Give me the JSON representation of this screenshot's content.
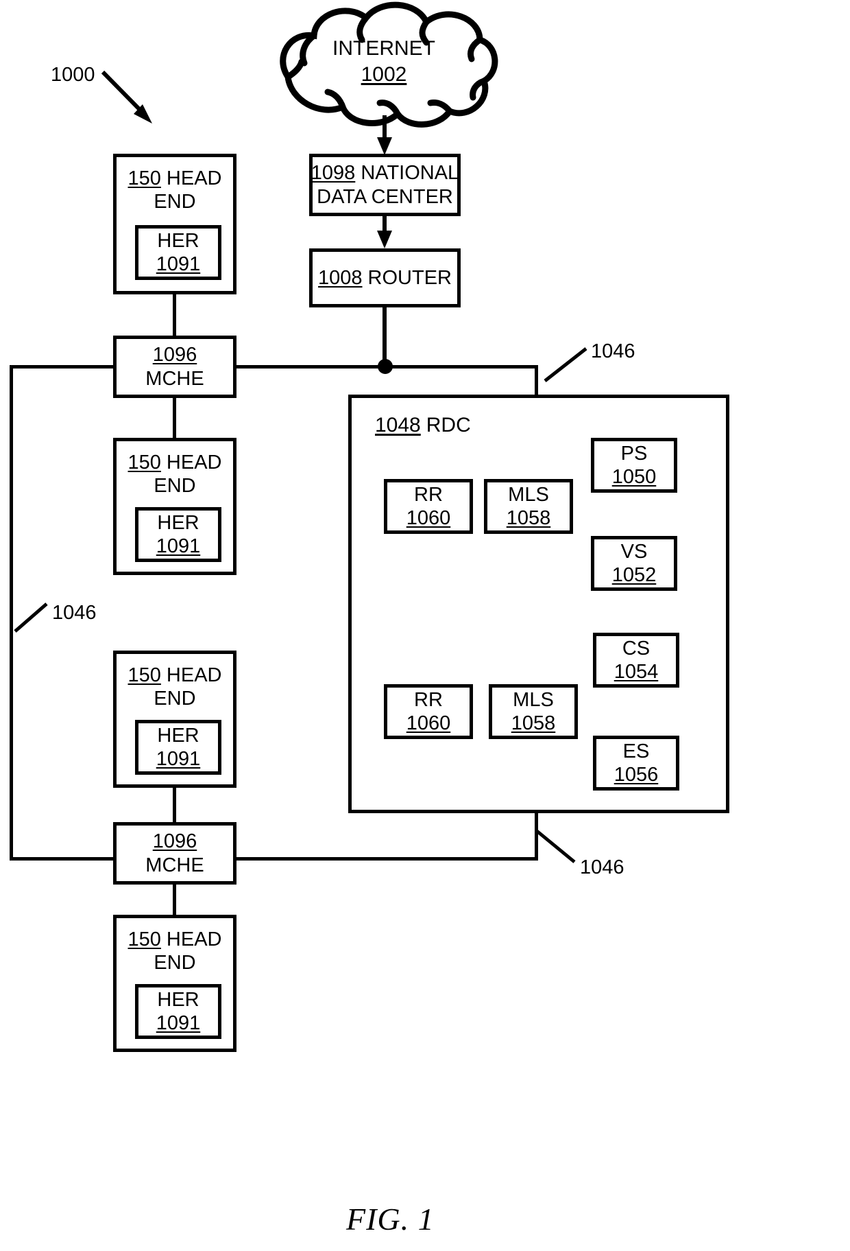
{
  "figure": {
    "caption": "FIG. 1",
    "system_ref": "1000"
  },
  "cloud": {
    "label": "INTERNET",
    "ref": "1002"
  },
  "nodes": {
    "national_data_center": {
      "ref": "1098",
      "label": "NATIONAL",
      "label2": "DATA CENTER"
    },
    "router": {
      "ref": "1008",
      "label": "ROUTER"
    },
    "head_ends": [
      {
        "ref": "150",
        "label": "HEAD",
        "label2": "END",
        "inner": {
          "label": "HER",
          "ref": "1091"
        }
      },
      {
        "ref": "150",
        "label": "HEAD",
        "label2": "END",
        "inner": {
          "label": "HER",
          "ref": "1091"
        }
      },
      {
        "ref": "150",
        "label": "HEAD",
        "label2": "END",
        "inner": {
          "label": "HER",
          "ref": "1091"
        }
      },
      {
        "ref": "150",
        "label": "HEAD",
        "label2": "END",
        "inner": {
          "label": "HER",
          "ref": "1091"
        }
      }
    ],
    "mche": [
      {
        "ref": "1096",
        "label": "MCHE"
      },
      {
        "ref": "1096",
        "label": "MCHE"
      }
    ],
    "rdc": {
      "ref": "1048",
      "label": "RDC",
      "components": [
        {
          "label": "RR",
          "ref": "1060"
        },
        {
          "label": "MLS",
          "ref": "1058"
        },
        {
          "label": "PS",
          "ref": "1050"
        },
        {
          "label": "VS",
          "ref": "1052"
        },
        {
          "label": "RR",
          "ref": "1060"
        },
        {
          "label": "MLS",
          "ref": "1058"
        },
        {
          "label": "CS",
          "ref": "1054"
        },
        {
          "label": "ES",
          "ref": "1056"
        }
      ]
    }
  },
  "link_refs": [
    {
      "ref": "1046"
    },
    {
      "ref": "1046"
    },
    {
      "ref": "1046"
    }
  ]
}
